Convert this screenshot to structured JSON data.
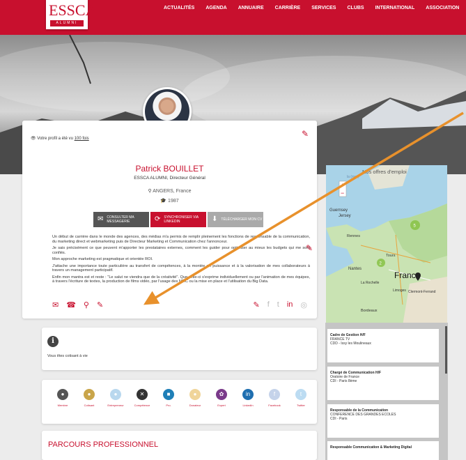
{
  "header": {
    "logo_text": "ESSCA",
    "logo_sub": "ALUMNI",
    "nav": [
      "ACTUALITÉS",
      "AGENDA",
      "ANNUAIRE",
      "CARRIÈRE",
      "SERVICES",
      "CLUBS",
      "INTERNATIONAL",
      "ASSOCIATION"
    ]
  },
  "profile": {
    "views_prefix": "Votre profil a été vu",
    "views_count": "100 fois",
    "name": "Patrick BOUILLET",
    "role": "ESSCA ALUMNI, Directeur Général",
    "location": "ANGERS, France",
    "year": "1987",
    "buttons": [
      {
        "label": "CONSULTER MA MESSAGERIE",
        "icon": "envelope-icon"
      },
      {
        "label": "SYNCHRONISER VIA LINKEDIN",
        "icon": "sync-icon"
      },
      {
        "label": "TÉLÉCHARGER MON CV",
        "icon": "download-icon"
      }
    ],
    "bio": [
      "Un début de carrière dans le monde des agences, des médias m'a permis de remplir pleinement les fonctions de responsable de la communication, du marketing direct et webmarketing puis de Directeur Marketing et Communication chez l'annonceur.",
      "Je sais précisément ce que peuvent m'apporter les prestataires externes, comment les guider pour optimiser au mieux les budgets qui me sont confiés.",
      "Mon approche marketing est pragmatique et orientée ROI.",
      "J'attache une importance toute particulière au transfert de compétences, à la montée en puissance et à la valorisation de mes collaborateurs à travers un management participatif.",
      "Enfin mon mantra est et reste : \"Le salut ne viendra que de la créativité\". Que celle-ci s'exprime individuellement ou par l'animation de mes équipes, à travers l'écriture de textes, la production de films vidéo, par l'usage des NTIC ou la mise en place et l'utilisation du Big Data."
    ]
  },
  "info": {
    "text": "Vous êtes cotisant à vie"
  },
  "badges": [
    {
      "label": "Membre",
      "color": "#555555"
    },
    {
      "label": "Cotisant",
      "color": "#c9a54a"
    },
    {
      "label": "Entrepreneur",
      "color": "#b9d8ee"
    },
    {
      "label": "Compétence",
      "color": "#333333"
    },
    {
      "label": "Pro.",
      "color": "#1f7fb7"
    },
    {
      "label": "Donateur",
      "color": "#f0d59a"
    },
    {
      "label": "Expert",
      "color": "#7a3a8a"
    },
    {
      "label": "LinkedIn",
      "color": "#1f6fb0"
    },
    {
      "label": "Facebook",
      "color": "#c5d3ea"
    },
    {
      "label": "Twitter",
      "color": "#bcdcf2"
    }
  ],
  "parcours": {
    "title": "PARCOURS PROFESSIONNEL"
  },
  "offers": {
    "title": "Nos offres d'emploi",
    "map_labels": {
      "guernsey": "Guernsey",
      "jersey": "Jersey",
      "rennes": "Rennes",
      "nantes": "Nantes",
      "tours": "Tours",
      "france": "France",
      "la_rochelle": "La Rochelle",
      "limoges": "Limoges",
      "clermont": "Clermont-Ferrand",
      "bordeaux": "Bordeaux",
      "channel": "la (mer)",
      "cluster_1": "5",
      "cluster_2": "2"
    },
    "jobs": [
      {
        "title": "Cadre de Gestion H/F",
        "company": "FRANCE TV",
        "contract": "CDD - Issy les Moulineaux"
      },
      {
        "title": "Chargé de Communication H/F",
        "company": "Oratoire de France",
        "contract": "CDI - Paris 8ème"
      },
      {
        "title": "Responsable de la Communication",
        "company": "CONFERENCE DES GRANDES ECOLES",
        "contract": "CDI - Paris"
      },
      {
        "title": "Responsable Communication & Marketing Digital",
        "company": "",
        "contract": ""
      }
    ]
  }
}
